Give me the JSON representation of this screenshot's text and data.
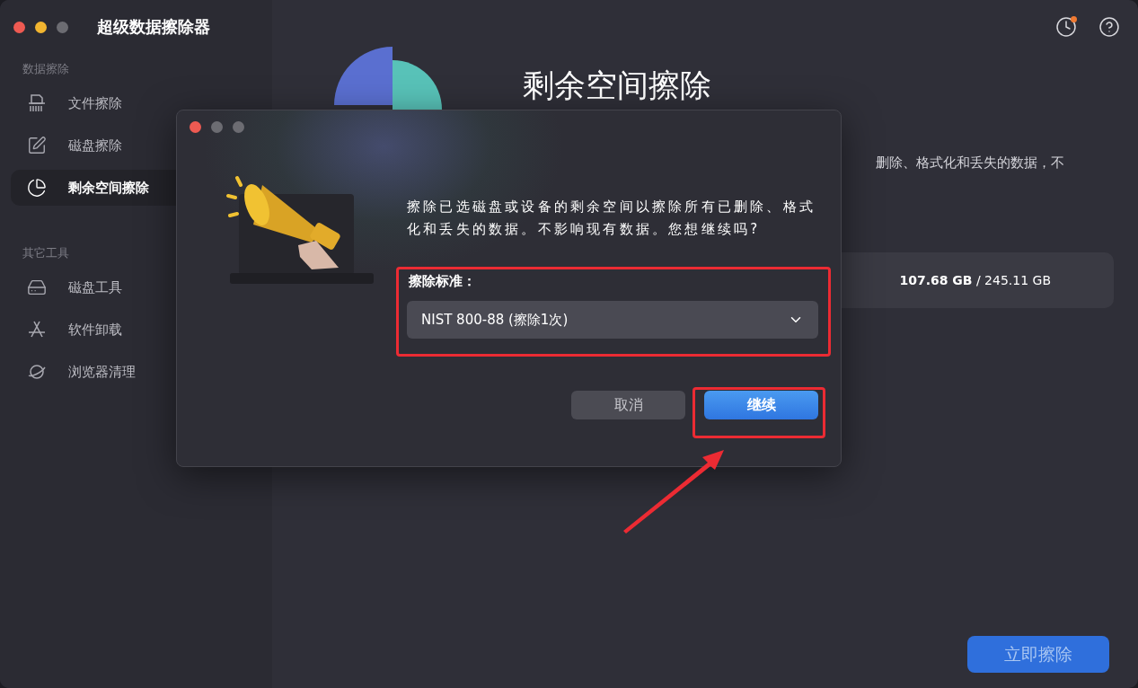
{
  "window": {
    "title": "超级数据擦除器"
  },
  "sidebar": {
    "sections": [
      {
        "heading": "数据擦除",
        "items": [
          {
            "label": "文件擦除",
            "selected": false
          },
          {
            "label": "磁盘擦除",
            "selected": false
          },
          {
            "label": "剩余空间擦除",
            "selected": true
          }
        ]
      },
      {
        "heading": "其它工具",
        "items": [
          {
            "label": "磁盘工具",
            "selected": false
          },
          {
            "label": "软件卸载",
            "selected": false
          },
          {
            "label": "浏览器清理",
            "selected": false
          }
        ]
      }
    ]
  },
  "main": {
    "title": "剩余空间擦除",
    "description": "删除、格式化和丢失的数据，不",
    "storage": "**107.68 GB** / 245.11 GB",
    "erase_button": "立即擦除"
  },
  "dialog": {
    "message": "擦除已选磁盘或设备的剩余空间以擦除所有已删除、格式化和丢失的数据。不影响现有数据。您想继续吗?",
    "field_label": "擦除标准：",
    "select_value": "NIST 800-88 (擦除1次)",
    "buttons": [
      {
        "label": "取消",
        "kind": "secondary"
      },
      {
        "label": "继续",
        "kind": "primary"
      }
    ]
  }
}
